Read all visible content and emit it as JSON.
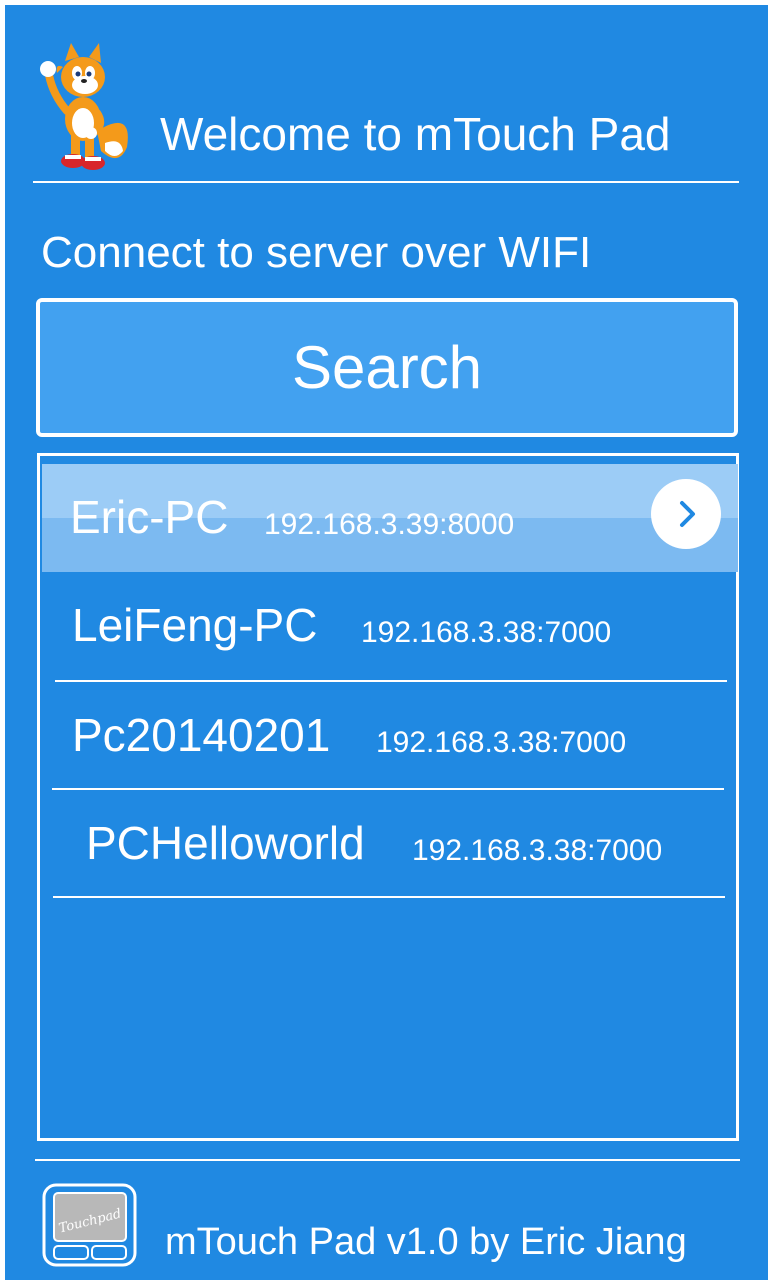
{
  "header": {
    "title": "Welcome to mTouch Pad",
    "mascot_icon": "fox-mascot-icon"
  },
  "connect": {
    "label": "Connect to server over WIFI",
    "search_label": "Search"
  },
  "servers": [
    {
      "name": "Eric-PC",
      "address": "192.168.3.39:8000",
      "selected": true
    },
    {
      "name": "LeiFeng-PC",
      "address": "192.168.3.38:7000",
      "selected": false
    },
    {
      "name": "Pc20140201",
      "address": "192.168.3.38:7000",
      "selected": false
    },
    {
      "name": "PCHelloworld",
      "address": "192.168.3.38:7000",
      "selected": false
    }
  ],
  "footer": {
    "logo_text": "Touchpad",
    "credit": "mTouch Pad v1.0 by Eric Jiang"
  },
  "colors": {
    "background": "#2089e2",
    "button": "#42a1f0",
    "selected_row": "#9cccf6",
    "chevron": "#2089e2"
  }
}
